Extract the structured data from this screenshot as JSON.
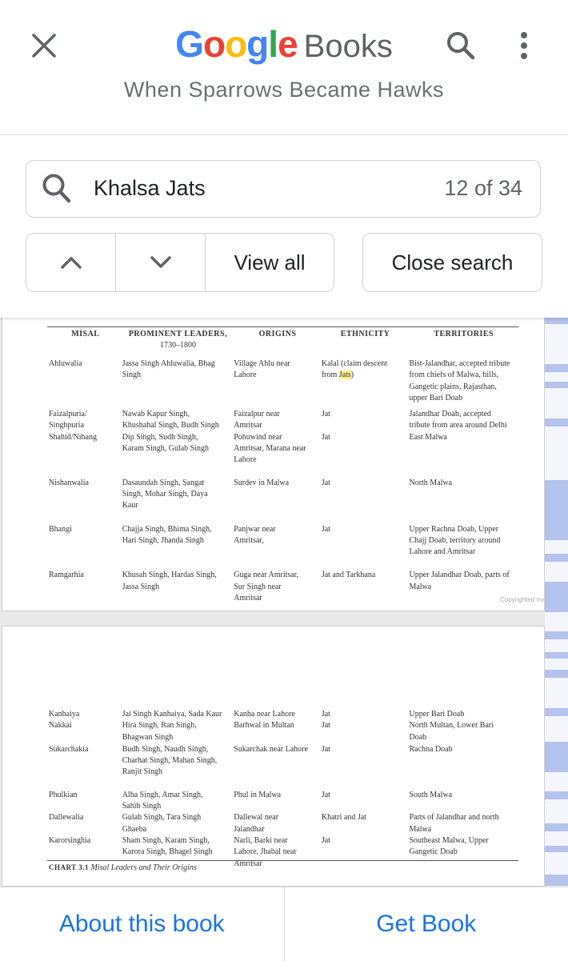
{
  "header": {
    "logo_google": [
      "G",
      "o",
      "o",
      "g",
      "l",
      "e"
    ],
    "logo_colors": [
      "#4285F4",
      "#EA4335",
      "#FBBC05",
      "#4285F4",
      "#34A853",
      "#EA4335"
    ],
    "logo_books": "Books",
    "book_title": "When Sparrows Became Hawks",
    "icons": {
      "close": "close-icon",
      "search": "search-icon",
      "more": "more-vert-icon"
    }
  },
  "search": {
    "query": "Khalsa Jats",
    "result_count": "12 of 34",
    "view_all_label": "View all",
    "close_search_label": "Close search",
    "icons": {
      "prev": "chevron-up-icon",
      "next": "chevron-down-icon"
    }
  },
  "page1": {
    "headers": {
      "c0": "MISAL",
      "c1": "PROMINENT LEADERS,",
      "c1_sub": "1730–1800",
      "c2": "ORIGINS",
      "c3": "ETHNICITY",
      "c4": "TERRITORIES"
    },
    "rows": [
      {
        "c0": [
          "Ahluwalia"
        ],
        "c1": [
          "Jassa Singh Ahluwalia, Bhag",
          "Singh"
        ],
        "c2": [
          "Village Ahlu near",
          "Lahore"
        ],
        "c3_line1": "Kalal (claim descent",
        "c3_line2_pre": "from ",
        "c3_line2_hl": "Jats",
        "c3_line2_post": ")",
        "c4": [
          "Bist-Jalandhar, accepted tribute",
          "from chiefs of Malwa, hills,",
          "Gangetic plains, Rajasthan,",
          "upper Bari Doab"
        ]
      },
      {
        "c0": [
          "Faizalpuria/",
          "Singhpuria"
        ],
        "c1": [
          "Nawab Kapur Singh,",
          "Khushahal Singh, Budh Singh"
        ],
        "c2": [
          "Faizalpur near",
          "Amritsar"
        ],
        "c3": [
          "Jat"
        ],
        "c4": [
          "Jalandhar Doab, accepted",
          "tribute from area around Delhi"
        ]
      },
      {
        "c0": [
          "Shahid/Nihang"
        ],
        "c1": [
          "Dip Singh, Sudh Singh,",
          "Karam Singh, Gulab Singh"
        ],
        "c2": [
          "Pohuwind near",
          "Amritsar, Marana near",
          "Lahore"
        ],
        "c3": [
          "Jat"
        ],
        "c4": [
          "East Malwa"
        ]
      },
      {
        "c0": [
          "Nishanwalia"
        ],
        "c1": [
          "Dasaundah Singh, Sangat",
          "Singh, Mohar Singh, Daya",
          "Kaur"
        ],
        "c2": [
          "Surdev in Malwa"
        ],
        "c3": [
          "Jat"
        ],
        "c4": [
          "North Malwa"
        ]
      },
      {
        "c0": [
          "Bhangi"
        ],
        "c1": [
          "Chajja Singh, Bhima Singh,",
          "Hari Singh, Jhanda Singh"
        ],
        "c2": [
          "Panjwar near",
          "Amritsar,"
        ],
        "c3": [
          "Jat"
        ],
        "c4": [
          "Upper Rachna Doab, Upper",
          "Chajj Doab, territory around",
          "Lahore and Amritsar"
        ]
      },
      {
        "c0": [
          "Ramgarhia"
        ],
        "c1": [
          "Khusah Singh, Hardas Singh,",
          "Jassa Singh"
        ],
        "c2": [
          "Guga near Amritsar,",
          "Sur Singh near",
          "Amritsar"
        ],
        "c3": [
          "Jat and Tarkhana"
        ],
        "c4": [
          "Upper Jalandhar Doab, parts of",
          "Malwa"
        ]
      }
    ],
    "copyright": "Copyrighted ma"
  },
  "page2": {
    "rows": [
      {
        "c0": [
          "Kanhaiya"
        ],
        "c1": [
          "Jai Singh Kanhaiya, Sada Kaur"
        ],
        "c2": [
          "Kanha near Lahore"
        ],
        "c3": [
          "Jat"
        ],
        "c4": [
          "Upper Bari Doab"
        ]
      },
      {
        "c0": [
          "Nakkai"
        ],
        "c1": [
          "Hira Singh, Ran Singh,",
          "Bhagwan Singh"
        ],
        "c2": [
          "Barhwal in Multan"
        ],
        "c3": [
          "Jat"
        ],
        "c4": [
          "North Multan, Lower Bari",
          "Doab"
        ]
      },
      {
        "c0": [
          "Sukarchakia"
        ],
        "c1": [
          "Budh Singh, Naudh Singh,",
          "Charhat Singh, Mahan Singh,",
          "Ranjit Singh"
        ],
        "c2": [
          "Sukarchak near Lahore"
        ],
        "c3": [
          "Jat"
        ],
        "c4": [
          "Rachna Doab"
        ]
      },
      {
        "c0": [
          "Phulkian"
        ],
        "c1": [
          "Alha Singh, Amar Singh,",
          "Sahib Singh"
        ],
        "c2": [
          "Phul in Malwa"
        ],
        "c3": [
          "Jat"
        ],
        "c4": [
          "South Malwa"
        ]
      },
      {
        "c0": [
          "Dallewalia"
        ],
        "c1": [
          "Gulab Singh, Tara Singh",
          "Ghaeba"
        ],
        "c2": [
          "Dallewal near",
          "Jalandhar"
        ],
        "c3": [
          "Khatri and Jat"
        ],
        "c4": [
          "Parts of Jalandhar and north",
          "Malwa"
        ]
      },
      {
        "c0": [
          "Karorsinghia"
        ],
        "c1": [
          "Sham Singh, Karam Singh,",
          "Karora Singh, Bhagel Singh"
        ],
        "c2": [
          "Narli, Barki near",
          "Lahore, Jhabal near",
          "Amritsar"
        ],
        "c3": [
          "Jat"
        ],
        "c4": [
          "Southeast Malwa, Upper",
          "Gangetic Doab"
        ]
      }
    ],
    "caption_label": "CHART 3.1",
    "caption_text": "Misal Leaders and Their Origins"
  },
  "bottom_bar": {
    "about_label": "About this book",
    "get_book_label": "Get Book"
  },
  "colors": {
    "accent_blue": "#1a73e8",
    "search_highlight": "#fff28a",
    "scrubber_mark": "#b4c3ec"
  }
}
